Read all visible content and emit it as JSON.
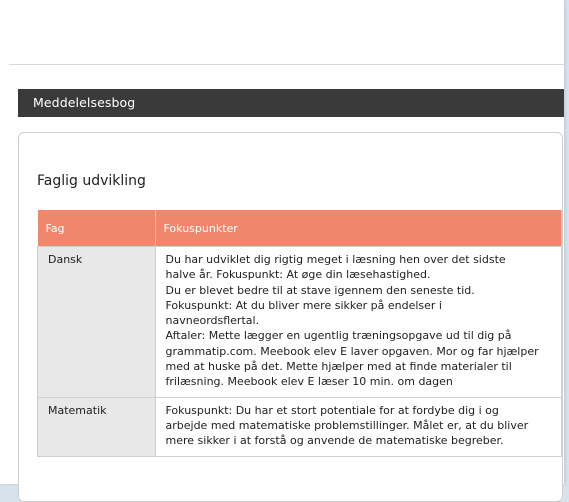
{
  "section_header": "Meddelelsesbog",
  "card": {
    "title": "Faglig udvikling",
    "table": {
      "headers": [
        "Fag",
        "Fokuspunkter"
      ],
      "rows": [
        {
          "subject": "Dansk",
          "lines": [
            "Du har udviklet dig rigtig meget i læsning hen over det sidste",
            "halve år. Fokuspunkt: At øge din læsehastighed.",
            "Du er blevet bedre til at stave igennem den seneste tid.",
            "Fokuspunkt: At du bliver mere sikker på endelser i",
            "navneordsflertal.",
            "Aftaler: Mette lægger en ugentlig træningsopgave ud til dig på",
            "grammatip.com. Meebook elev E laver opgaven. Mor og far hjælper",
            "med at huske på det. Mette hjælper med at finde materialer til",
            "frilæsning. Meebook elev E læser 10 min. om dagen"
          ]
        },
        {
          "subject": "Matematik",
          "lines": [
            "Fokuspunkt: Du har et stort potentiale for at fordybe dig i og",
            "arbejde med matematiske problemstillinger. Målet er, at du bliver",
            "mere sikker i at forstå og anvende de matematiske begreber."
          ]
        }
      ]
    }
  },
  "colors": {
    "header_bg": "#3a3a3a",
    "table_header_bg": "#f0866b",
    "subject_cell_bg": "#e8e8e8",
    "backdrop": "#d6e3ec"
  }
}
